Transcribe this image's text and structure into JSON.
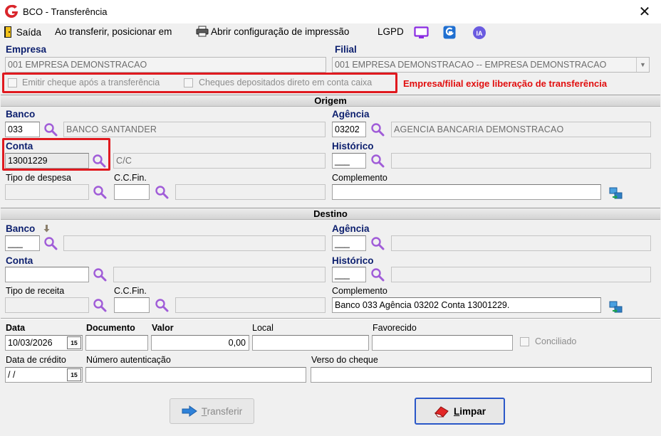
{
  "window": {
    "title": "BCO - Transferência",
    "close_glyph": "✕"
  },
  "toolbar": {
    "exit_label": "Saída",
    "position_label": "Ao transferir, posicionar em",
    "print_config_label": "Abrir configuração de impressão",
    "lgpd_label": "LGPD"
  },
  "header": {
    "empresa_label": "Empresa",
    "empresa_value": "001 EMPRESA DEMONSTRACAO",
    "filial_label": "Filial",
    "filial_value": "001 EMPRESA DEMONSTRACAO -- EMPRESA DEMONSTRACAO",
    "emitir_cheque_label": "Emitir cheque após a transferência",
    "cheques_depositados_label": "Cheques depositados direto em conta caixa",
    "warning": "Empresa/filial exige liberação de transferência"
  },
  "origem": {
    "section_title": "Origem",
    "banco_label": "Banco",
    "banco_code": "033",
    "banco_name": "BANCO SANTANDER",
    "agencia_label": "Agência",
    "agencia_code": "03202",
    "agencia_name": "AGENCIA BANCARIA DEMONSTRACAO",
    "conta_label": "Conta",
    "conta_value": "13001229",
    "conta_desc": "C/C",
    "historico_label": "Histórico",
    "historico_value": "___",
    "tipo_despesa_label": "Tipo de despesa",
    "ccfin_label": "C.C.Fin.",
    "complemento_label": "Complemento"
  },
  "destino": {
    "section_title": "Destino",
    "banco_label": "Banco",
    "banco_code": "___",
    "agencia_label": "Agência",
    "agencia_code": "___",
    "conta_label": "Conta",
    "historico_label": "Histórico",
    "historico_value": "___",
    "tipo_receita_label": "Tipo de receita",
    "ccfin_label": "C.C.Fin.",
    "complemento_label": "Complemento",
    "complemento_value": "Banco 033 Agência 03202 Conta 13001229."
  },
  "footer": {
    "data_label": "Data",
    "data_value": "10/03/2026",
    "documento_label": "Documento",
    "valor_label": "Valor",
    "valor_value": "0,00",
    "local_label": "Local",
    "favorecido_label": "Favorecido",
    "conciliado_label": "Conciliado",
    "data_credito_label": "Data de crédito",
    "data_credito_value": " / /",
    "numero_autenticacao_label": "Número autenticação",
    "verso_cheque_label": "Verso do cheque",
    "calendar_glyph": "15"
  },
  "buttons": {
    "transferir_first": "T",
    "transferir_rest": "ransferir",
    "limpar_first": "L",
    "limpar_rest": "impar"
  },
  "colors": {
    "label_blue": "#0c1f6e",
    "warning_red": "#e10d0d",
    "highlight_red": "#e0191f",
    "lookup_purple": "#a05cd8"
  }
}
